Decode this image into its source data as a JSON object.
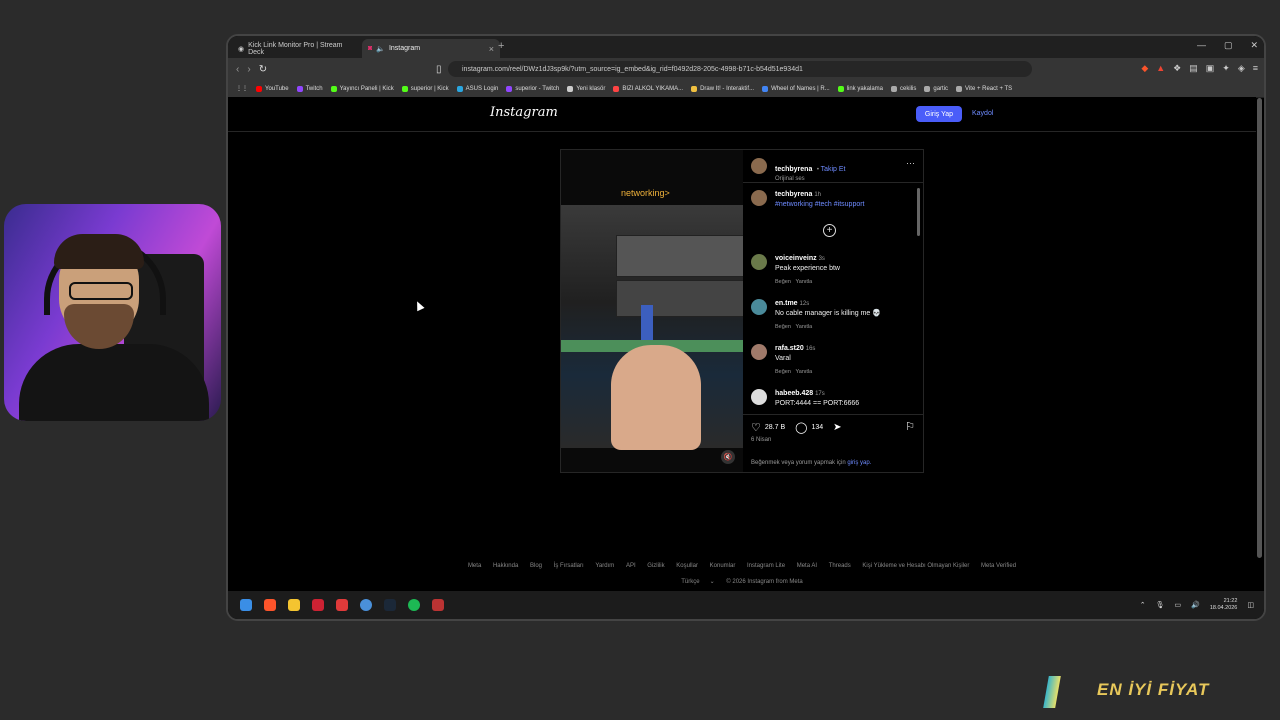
{
  "browser": {
    "tabs": [
      {
        "label": "Kick Link Monitor Pro | Stream Deck"
      },
      {
        "label": "Instagram"
      }
    ],
    "url": "instagram.com/reel/DWz1dJ3sp9k/?utm_source=ig_embed&ig_rid=f0492d28-205c-4998-b71c-b54d51e934d1",
    "bookmarks": [
      {
        "label": "YouTube",
        "color": "#ff0000"
      },
      {
        "label": "Twitch",
        "color": "#9146ff"
      },
      {
        "label": "Yayıncı Paneli | Kick",
        "color": "#53fc18"
      },
      {
        "label": "superior | Kick",
        "color": "#53fc18"
      },
      {
        "label": "ASUS Login",
        "color": "#2aa6e0"
      },
      {
        "label": "superior - Twitch",
        "color": "#9146ff"
      },
      {
        "label": "Yeni klasör",
        "color": "#cccccc"
      },
      {
        "label": "BIZI ALKOL YIKAMA...",
        "color": "#ff4444"
      },
      {
        "label": "Draw It! - Interaktif...",
        "color": "#f0c040"
      },
      {
        "label": "Wheel of Names | R...",
        "color": "#4285f4"
      },
      {
        "label": "link yakalama",
        "color": "#53fc18"
      },
      {
        "label": "cekilis",
        "color": "#aaaaaa"
      },
      {
        "label": "gartic",
        "color": "#aaaaaa"
      },
      {
        "label": "Vite + React + TS",
        "color": "#aaaaaa"
      }
    ]
  },
  "instagram": {
    "logo": "Instagram",
    "login_button": "Giriş Yap",
    "signup_link": "Kaydol",
    "video_caption": "networking>",
    "post_author": "techbyrena",
    "follow_link": "Takip Et",
    "audio": "Orijinal ses",
    "caption_time": "1h",
    "caption_text": "#networking #tech #itsupport",
    "comments": [
      {
        "user": "voiceinveinz",
        "time": "3s",
        "text": "Peak experience btw",
        "like": "Beğen",
        "reply": "Yanıtla"
      },
      {
        "user": "en.tme",
        "time": "12s",
        "text": "No cable manager is killing me 💀",
        "like": "Beğen",
        "reply": "Yanıtla"
      },
      {
        "user": "rafa.st20",
        "time": "16s",
        "text": "Varal",
        "like": "Beğen",
        "reply": "Yanıtla"
      },
      {
        "user": "habeeb.428",
        "time": "17s",
        "text": "PORT:4444 == PORT:6666",
        "like": "",
        "reply": ""
      }
    ],
    "likes": "28.7 B",
    "comment_count": "134",
    "date": "6 Nisan",
    "login_prompt_prefix": "Beğenmek veya yorum yapmak için",
    "login_prompt_link": "giriş yap.",
    "footer_links": [
      "Meta",
      "Hakkında",
      "Blog",
      "İş Fırsatları",
      "Yardım",
      "API",
      "Gizlilik",
      "Koşullar",
      "Konumlar",
      "Instagram Lite",
      "Meta AI",
      "Threads",
      "Kişi Yükleme ve Hesabı Olmayan Kişiler",
      "Meta Verified"
    ],
    "language": "Türkçe",
    "copyright": "© 2026 Instagram from Meta"
  },
  "taskbar": {
    "time": "21:22",
    "date": "18.04.2026"
  },
  "overlay": {
    "promo_text": "EN İYİ FİYAT"
  }
}
